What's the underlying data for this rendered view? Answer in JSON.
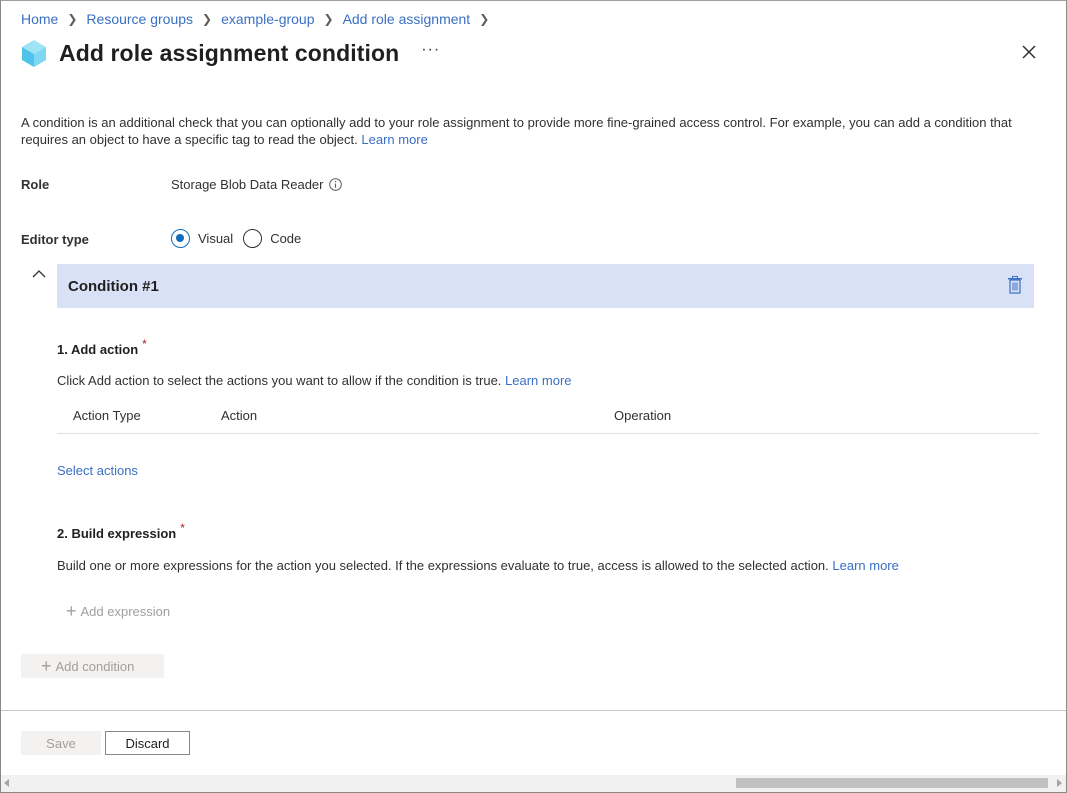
{
  "breadcrumb": [
    "Home",
    "Resource groups",
    "example-group",
    "Add role assignment"
  ],
  "title": "Add role assignment condition",
  "more": "···",
  "description": "A condition is an additional check that you can optionally add to your role assignment to provide more fine-grained access control. For example, you can add a condition that requires an object to have a specific tag to read the object.",
  "learn_more": "Learn more",
  "role": {
    "label": "Role",
    "value": "Storage Blob Data Reader"
  },
  "editor": {
    "label": "Editor type",
    "options": [
      "Visual",
      "Code"
    ],
    "selected": "Visual"
  },
  "condition": {
    "title": "Condition #1",
    "add_action": {
      "title": "1. Add action",
      "required": "*",
      "desc": "Click Add action to select the actions you want to allow if the condition is true.",
      "columns": [
        "Action Type",
        "Action",
        "Operation"
      ],
      "select_actions": "Select actions"
    },
    "build_expression": {
      "title": "2. Build expression",
      "required": "*",
      "desc": "Build one or more expressions for the action you selected. If the expressions evaluate to true, access is allowed to the selected action.",
      "add_expression": "Add expression"
    }
  },
  "add_condition": "Add condition",
  "footer": {
    "save": "Save",
    "discard": "Discard"
  },
  "colors": {
    "accent": "#0f6cbd",
    "link": "#3a6fc4",
    "condition_header": "#d9e1f7"
  }
}
